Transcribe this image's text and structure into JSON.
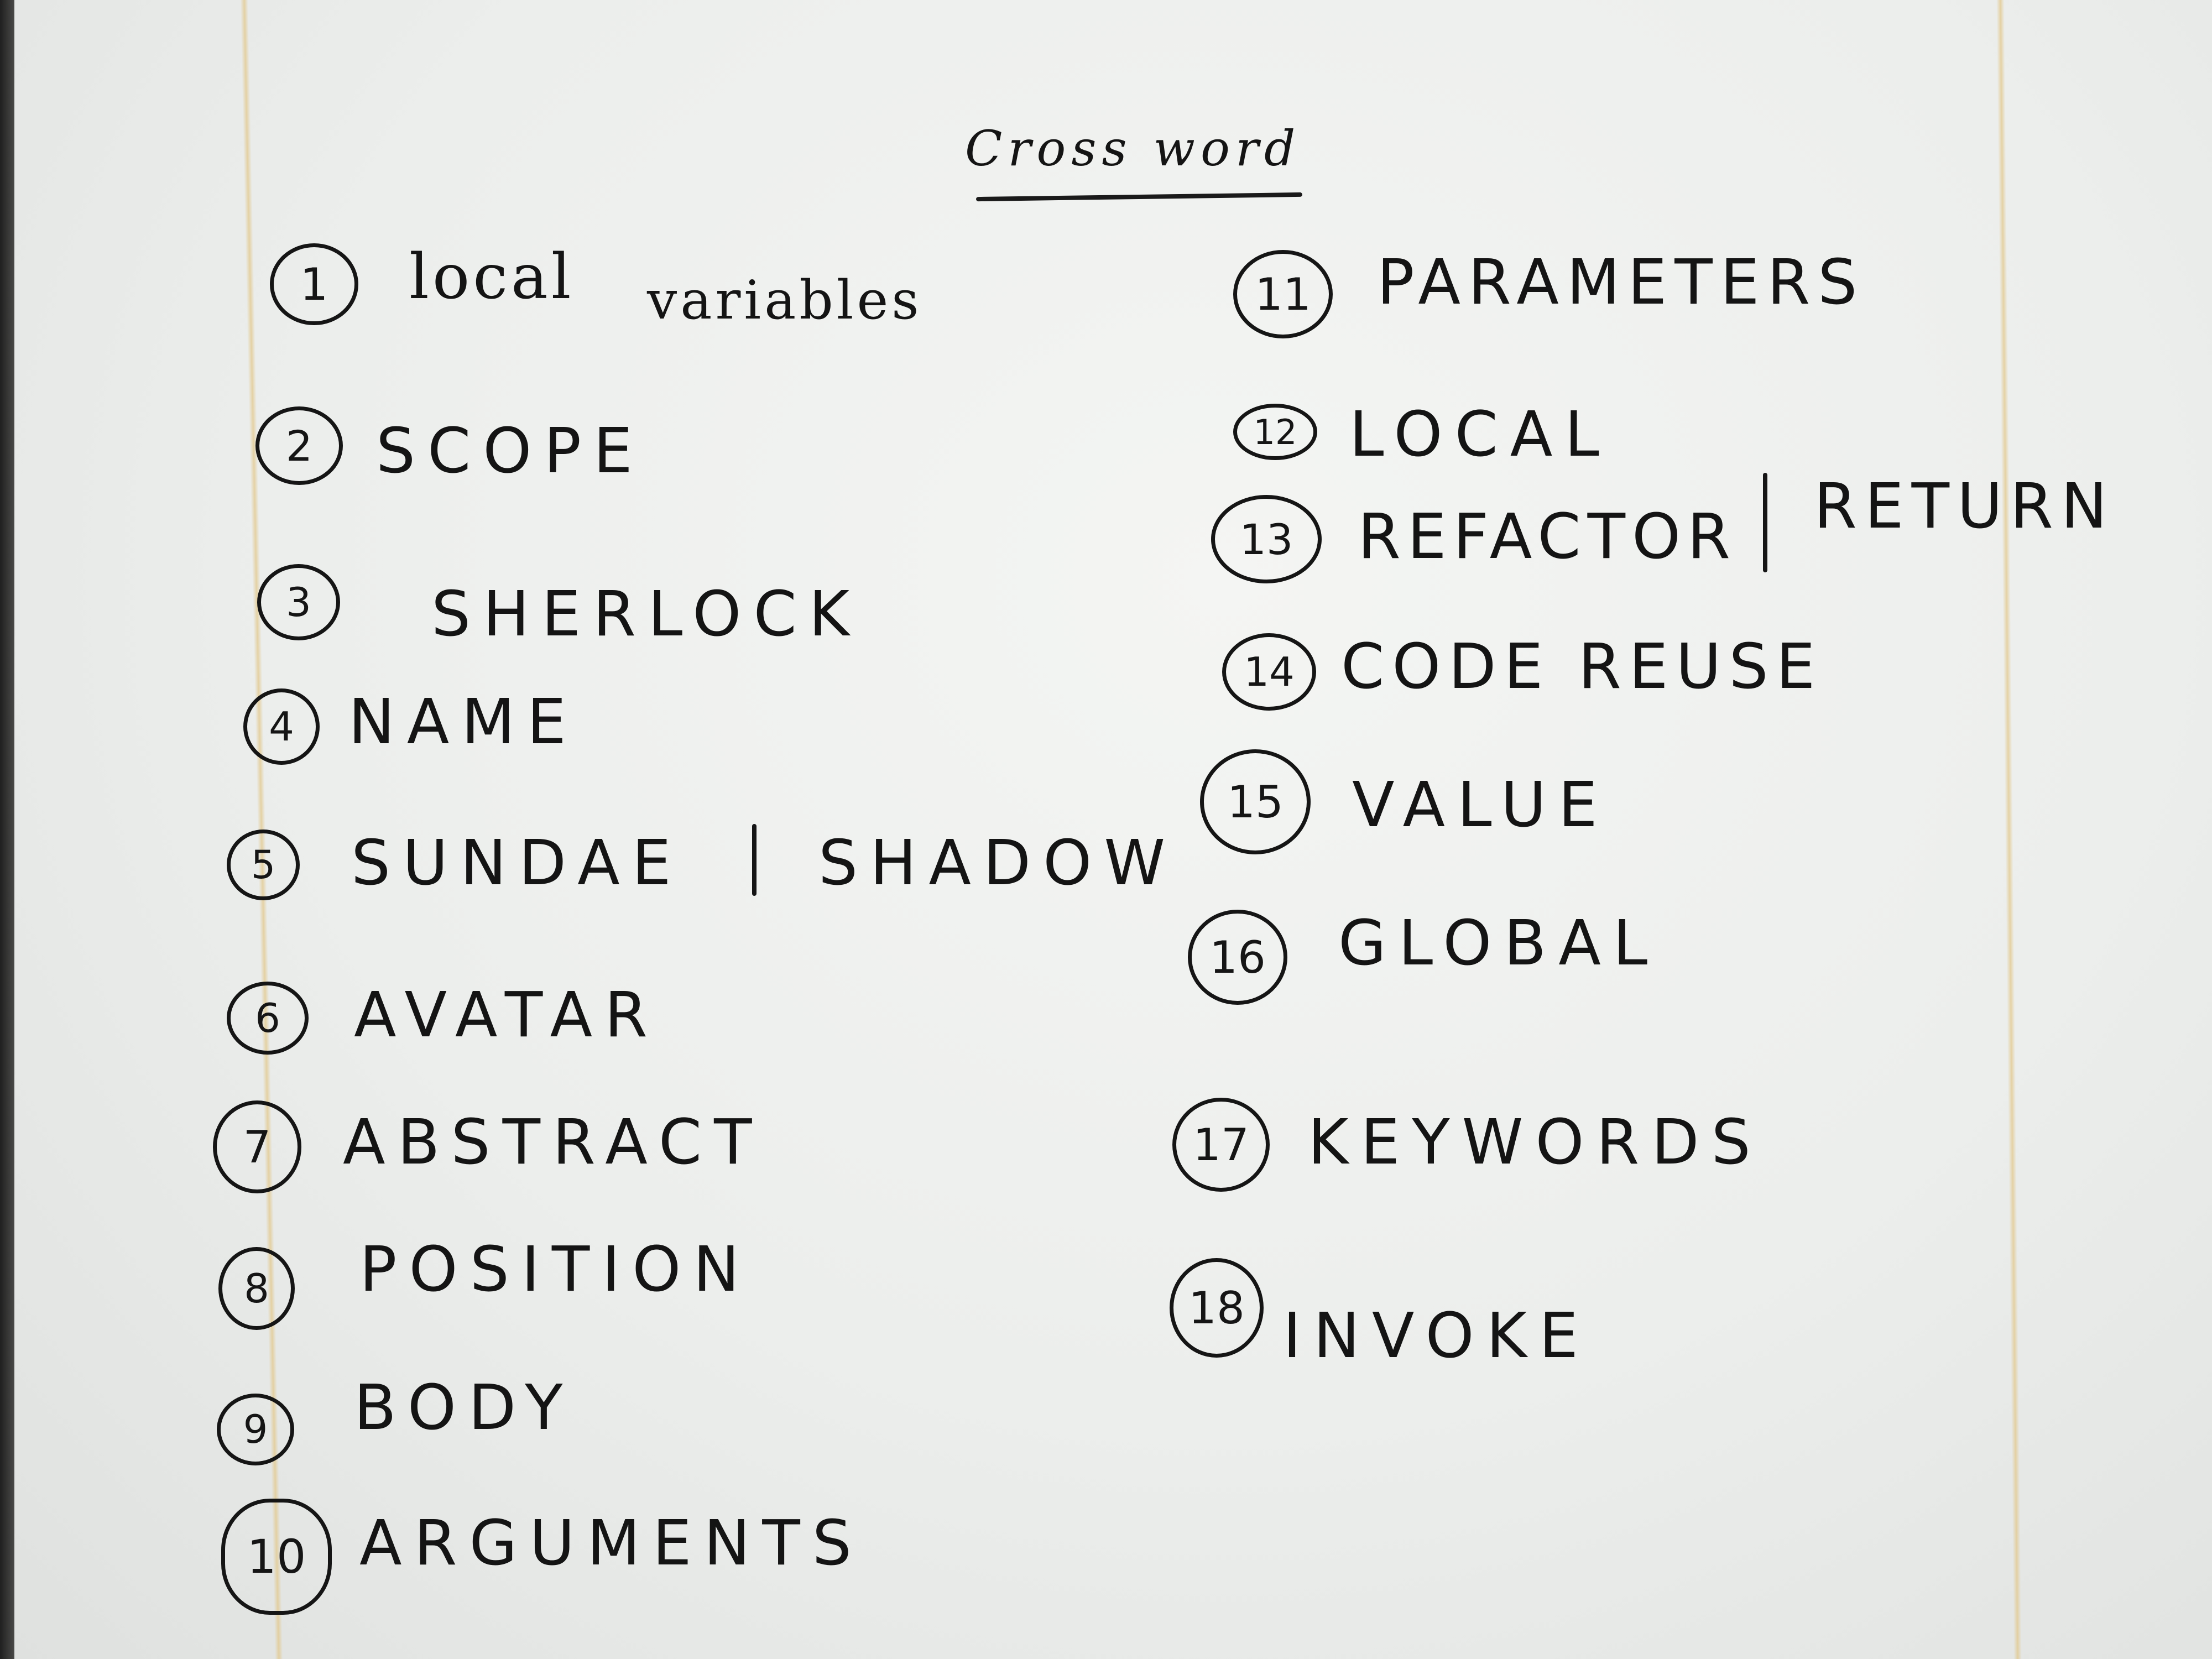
{
  "title": "Cross word",
  "left_column": [
    {
      "number": "1",
      "answer": "local",
      "extra": "variables"
    },
    {
      "number": "2",
      "answer": "SCOPE"
    },
    {
      "number": "3",
      "answer": "SHERLOCK"
    },
    {
      "number": "4",
      "answer": "NAME"
    },
    {
      "number": "5",
      "answer": "SUNDAE",
      "alternate": "SHADOW"
    },
    {
      "number": "6",
      "answer": "AVATAR"
    },
    {
      "number": "7",
      "answer": "ABSTRACT"
    },
    {
      "number": "8",
      "answer": "POSITION"
    },
    {
      "number": "9",
      "answer": "BODY"
    },
    {
      "number": "10",
      "answer": "ARGUMENTS"
    }
  ],
  "right_column": [
    {
      "number": "11",
      "answer": "PARAMETERS"
    },
    {
      "number": "12",
      "answer": "LOCAL"
    },
    {
      "number": "13",
      "answer": "REFACTOR",
      "alternate": "RETURN"
    },
    {
      "number": "14",
      "answer": "CODE REUSE"
    },
    {
      "number": "15",
      "answer": "VALUE"
    },
    {
      "number": "16",
      "answer": "GLOBAL"
    },
    {
      "number": "17",
      "answer": "KEYWORDS"
    },
    {
      "number": "18",
      "answer": "INVOKE"
    }
  ]
}
